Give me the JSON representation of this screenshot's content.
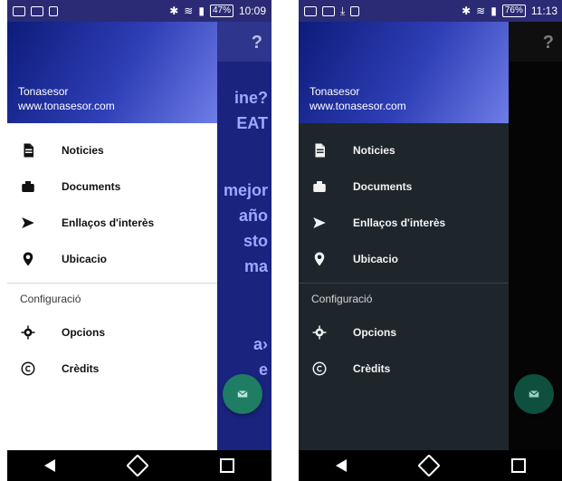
{
  "screens": [
    {
      "status_bar": {
        "time": "10:09",
        "battery": "47%"
      },
      "header": {
        "name": "Tonasesor",
        "url": "www.tonasesor.com"
      },
      "menu_items": [
        {
          "label": "Noticies",
          "icon": "file-icon"
        },
        {
          "label": "Documents",
          "icon": "briefcase-icon"
        },
        {
          "label": "Enllaços d'interès",
          "icon": "send-icon"
        },
        {
          "label": "Ubicacio",
          "icon": "location-pin-icon"
        }
      ],
      "section_label": "Configuració",
      "settings_items": [
        {
          "label": "Opcions",
          "icon": "gear-icon"
        },
        {
          "label": "Crèdits",
          "icon": "copyright-icon"
        }
      ],
      "background_text": {
        "toolbar_symbol": "?",
        "lines": [
          "ine?",
          "EAT",
          "mejor",
          "año",
          "sto",
          "ma",
          "a›",
          "e"
        ]
      }
    },
    {
      "status_bar": {
        "time": "11:13",
        "battery": "76%"
      },
      "header": {
        "name": "Tonasesor",
        "url": "www.tonasesor.com"
      },
      "menu_items": [
        {
          "label": "Noticies",
          "icon": "file-icon"
        },
        {
          "label": "Documents",
          "icon": "briefcase-icon"
        },
        {
          "label": "Enllaços d'interès",
          "icon": "send-icon"
        },
        {
          "label": "Ubicacio",
          "icon": "location-pin-icon"
        }
      ],
      "section_label": "Configuració",
      "settings_items": [
        {
          "label": "Opcions",
          "icon": "gear-icon"
        },
        {
          "label": "Crèdits",
          "icon": "copyright-icon"
        }
      ],
      "background_text": {
        "toolbar_symbol": "?"
      }
    }
  ],
  "colors": {
    "drawer_light_bg": "#ffffff",
    "drawer_dark_bg": "#1f262b",
    "header_gradient_start": "#0d1b7a",
    "header_gradient_end": "#6f7de7",
    "fab_green": "#1e7d63"
  }
}
